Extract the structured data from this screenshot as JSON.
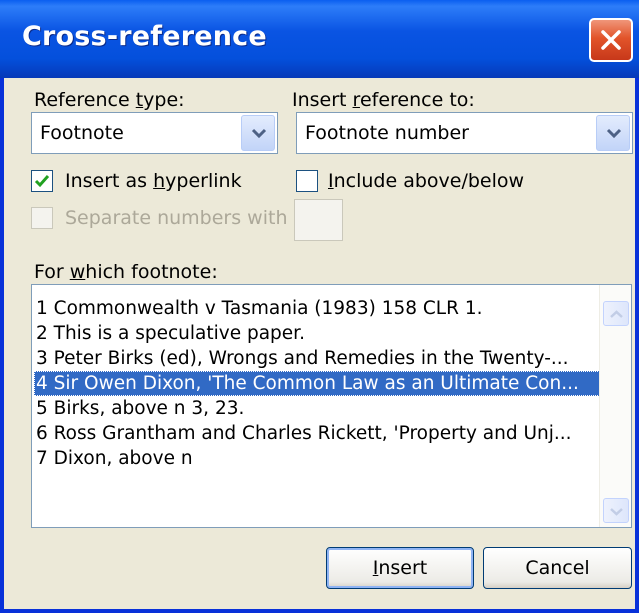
{
  "window": {
    "title": "Cross-reference"
  },
  "reference_type": {
    "label_pre": "Reference ",
    "label_ul": "t",
    "label_post": "ype:",
    "value": "Footnote"
  },
  "insert_reference_to": {
    "label_pre": "Insert ",
    "label_ul": "r",
    "label_post": "eference to:",
    "value": "Footnote number"
  },
  "hyperlink": {
    "label_pre": "Insert as ",
    "label_ul": "h",
    "label_post": "yperlink",
    "checked": true
  },
  "include_above_below": {
    "label_pre": "",
    "label_ul": "I",
    "label_post": "nclude above/below",
    "checked": false
  },
  "separate_numbers": {
    "label": "Separate numbers with",
    "checked": false,
    "enabled": false
  },
  "which_footnote": {
    "label_pre": "For ",
    "label_ul": "w",
    "label_post": "hich footnote:",
    "items": [
      "1  Commonwealth v Tasmania (1983) 158 CLR 1.",
      "2  This is a speculative paper.",
      "3  Peter Birks (ed), Wrongs and Remedies in the Twenty-...",
      "4  Sir Owen Dixon, 'The Common Law as an Ultimate Con...",
      "5  Birks, above n 3, 23.",
      "6  Ross Grantham and Charles Rickett, 'Property and Unj...",
      "7  Dixon, above n"
    ],
    "selected_index": 3
  },
  "buttons": {
    "insert_pre": "",
    "insert_ul": "I",
    "insert_post": "nsert",
    "cancel": "Cancel"
  },
  "icons": {
    "close": "close-icon",
    "dropdown": "chevron-down-icon",
    "check": "checkmark-icon",
    "scroll_up": "scroll-up-icon",
    "scroll_down": "scroll-down-icon"
  },
  "colors": {
    "title_bar": "#0a54e3",
    "dialog_bg": "#ece9d8",
    "selection": "#316ac5",
    "close_button": "#e2542a"
  }
}
